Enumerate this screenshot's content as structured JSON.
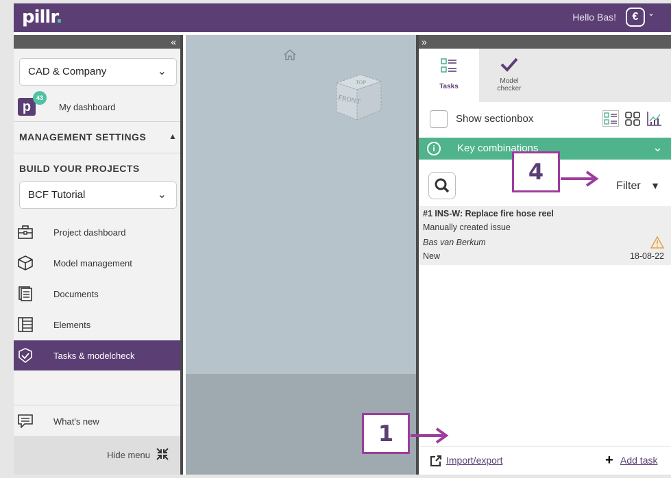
{
  "topbar": {
    "logo": "pillr",
    "logo_dot": ".",
    "greeting": "Hello Bas!",
    "user_icon": "user-avatar-icon"
  },
  "sidebar": {
    "collapse_glyph": "«",
    "company_select": "CAD & Company",
    "dashboard_badge": "43",
    "dashboard_label": "My dashboard",
    "management_title": "MANAGEMENT SETTINGS",
    "build_title": "BUILD YOUR PROJECTS",
    "project_select": "BCF Tutorial",
    "items": [
      {
        "label": "Project dashboard",
        "icon": "briefcase-icon"
      },
      {
        "label": "Model management",
        "icon": "cube-icon"
      },
      {
        "label": "Documents",
        "icon": "document-icon"
      },
      {
        "label": "Elements",
        "icon": "elements-icon"
      },
      {
        "label": "Tasks & modelcheck",
        "icon": "check-shield-icon",
        "active": true
      }
    ],
    "whats_new": "What's new",
    "hide_menu": "Hide menu"
  },
  "viewer": {
    "cube_top": "TOP",
    "cube_front": "FRONT"
  },
  "panel": {
    "expand_glyph": "»",
    "tabs": [
      {
        "label": "Tasks",
        "icon": "list-icon",
        "active": true
      },
      {
        "label": "Model\nchecker",
        "icon": "checkmark-icon"
      }
    ],
    "show_sectionbox": "Show sectionbox",
    "key_combinations": "Key combinations",
    "filter_label": "Filter",
    "issue": {
      "title": "#1  INS-W: Replace fire hose reel",
      "description": "Manually created issue",
      "author": "Bas van Berkum",
      "status": "New",
      "date": "18-08-22"
    },
    "import_export": "Import/export",
    "add_task": "Add task"
  },
  "annotations": {
    "one": "1",
    "four": "4"
  },
  "colors": {
    "brand_purple": "#5b3f74",
    "accent_green": "#4fb38b",
    "annotation": "#9c3d9c",
    "warning": "#e8a13a"
  }
}
